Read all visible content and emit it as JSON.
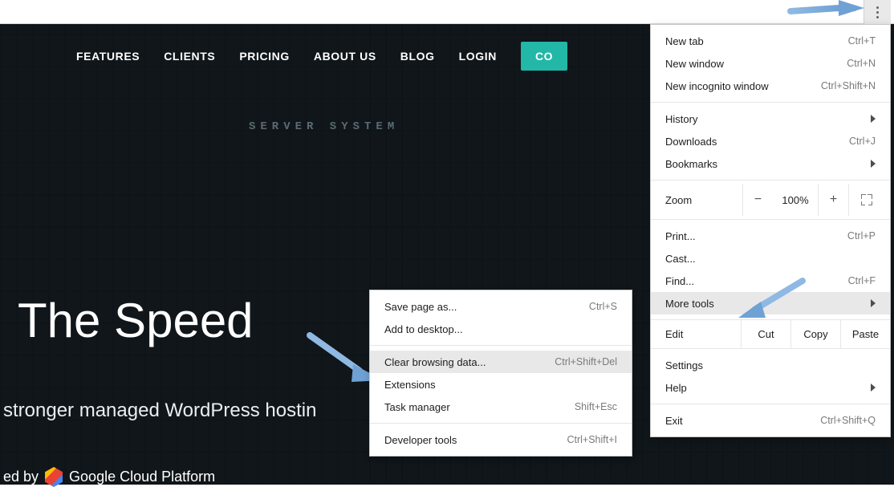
{
  "site": {
    "nav": {
      "features": "FEATURES",
      "clients": "CLIENTS",
      "pricing": "PRICING",
      "about": "ABOUT US",
      "blog": "BLOG",
      "login": "LOGIN",
      "cta": "CO"
    },
    "server_label": "SERVER SYSTEM",
    "headline": "The Speed",
    "subhead": "stronger managed WordPress hostin",
    "powered_by": "ed by",
    "gcp": "Google Cloud Platform"
  },
  "chrome_menu": {
    "new_tab": {
      "label": "New tab",
      "shortcut": "Ctrl+T"
    },
    "new_window": {
      "label": "New window",
      "shortcut": "Ctrl+N"
    },
    "new_incognito": {
      "label": "New incognito window",
      "shortcut": "Ctrl+Shift+N"
    },
    "history": {
      "label": "History"
    },
    "downloads": {
      "label": "Downloads",
      "shortcut": "Ctrl+J"
    },
    "bookmarks": {
      "label": "Bookmarks"
    },
    "zoom": {
      "label": "Zoom",
      "minus": "−",
      "percent": "100%",
      "plus": "+"
    },
    "print": {
      "label": "Print...",
      "shortcut": "Ctrl+P"
    },
    "cast": {
      "label": "Cast..."
    },
    "find": {
      "label": "Find...",
      "shortcut": "Ctrl+F"
    },
    "more_tools": {
      "label": "More tools"
    },
    "edit": {
      "label": "Edit",
      "cut": "Cut",
      "copy": "Copy",
      "paste": "Paste"
    },
    "settings": {
      "label": "Settings"
    },
    "help": {
      "label": "Help"
    },
    "exit": {
      "label": "Exit",
      "shortcut": "Ctrl+Shift+Q"
    }
  },
  "submenu": {
    "save_page": {
      "label": "Save page as...",
      "shortcut": "Ctrl+S"
    },
    "add_desktop": {
      "label": "Add to desktop..."
    },
    "clear_data": {
      "label": "Clear browsing data...",
      "shortcut": "Ctrl+Shift+Del"
    },
    "extensions": {
      "label": "Extensions"
    },
    "task_manager": {
      "label": "Task manager",
      "shortcut": "Shift+Esc"
    },
    "dev_tools": {
      "label": "Developer tools",
      "shortcut": "Ctrl+Shift+I"
    }
  }
}
